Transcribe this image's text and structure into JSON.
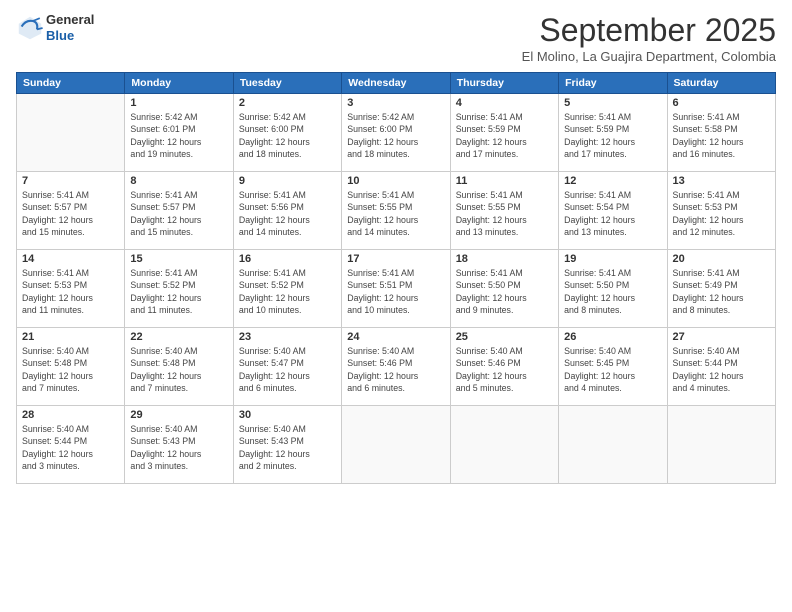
{
  "logo": {
    "general": "General",
    "blue": "Blue"
  },
  "title": "September 2025",
  "location": "El Molino, La Guajira Department, Colombia",
  "days_of_week": [
    "Sunday",
    "Monday",
    "Tuesday",
    "Wednesday",
    "Thursday",
    "Friday",
    "Saturday"
  ],
  "weeks": [
    [
      {
        "day": "",
        "info": ""
      },
      {
        "day": "1",
        "info": "Sunrise: 5:42 AM\nSunset: 6:01 PM\nDaylight: 12 hours\nand 19 minutes."
      },
      {
        "day": "2",
        "info": "Sunrise: 5:42 AM\nSunset: 6:00 PM\nDaylight: 12 hours\nand 18 minutes."
      },
      {
        "day": "3",
        "info": "Sunrise: 5:42 AM\nSunset: 6:00 PM\nDaylight: 12 hours\nand 18 minutes."
      },
      {
        "day": "4",
        "info": "Sunrise: 5:41 AM\nSunset: 5:59 PM\nDaylight: 12 hours\nand 17 minutes."
      },
      {
        "day": "5",
        "info": "Sunrise: 5:41 AM\nSunset: 5:59 PM\nDaylight: 12 hours\nand 17 minutes."
      },
      {
        "day": "6",
        "info": "Sunrise: 5:41 AM\nSunset: 5:58 PM\nDaylight: 12 hours\nand 16 minutes."
      }
    ],
    [
      {
        "day": "7",
        "info": "Sunrise: 5:41 AM\nSunset: 5:57 PM\nDaylight: 12 hours\nand 15 minutes."
      },
      {
        "day": "8",
        "info": "Sunrise: 5:41 AM\nSunset: 5:57 PM\nDaylight: 12 hours\nand 15 minutes."
      },
      {
        "day": "9",
        "info": "Sunrise: 5:41 AM\nSunset: 5:56 PM\nDaylight: 12 hours\nand 14 minutes."
      },
      {
        "day": "10",
        "info": "Sunrise: 5:41 AM\nSunset: 5:55 PM\nDaylight: 12 hours\nand 14 minutes."
      },
      {
        "day": "11",
        "info": "Sunrise: 5:41 AM\nSunset: 5:55 PM\nDaylight: 12 hours\nand 13 minutes."
      },
      {
        "day": "12",
        "info": "Sunrise: 5:41 AM\nSunset: 5:54 PM\nDaylight: 12 hours\nand 13 minutes."
      },
      {
        "day": "13",
        "info": "Sunrise: 5:41 AM\nSunset: 5:53 PM\nDaylight: 12 hours\nand 12 minutes."
      }
    ],
    [
      {
        "day": "14",
        "info": "Sunrise: 5:41 AM\nSunset: 5:53 PM\nDaylight: 12 hours\nand 11 minutes."
      },
      {
        "day": "15",
        "info": "Sunrise: 5:41 AM\nSunset: 5:52 PM\nDaylight: 12 hours\nand 11 minutes."
      },
      {
        "day": "16",
        "info": "Sunrise: 5:41 AM\nSunset: 5:52 PM\nDaylight: 12 hours\nand 10 minutes."
      },
      {
        "day": "17",
        "info": "Sunrise: 5:41 AM\nSunset: 5:51 PM\nDaylight: 12 hours\nand 10 minutes."
      },
      {
        "day": "18",
        "info": "Sunrise: 5:41 AM\nSunset: 5:50 PM\nDaylight: 12 hours\nand 9 minutes."
      },
      {
        "day": "19",
        "info": "Sunrise: 5:41 AM\nSunset: 5:50 PM\nDaylight: 12 hours\nand 8 minutes."
      },
      {
        "day": "20",
        "info": "Sunrise: 5:41 AM\nSunset: 5:49 PM\nDaylight: 12 hours\nand 8 minutes."
      }
    ],
    [
      {
        "day": "21",
        "info": "Sunrise: 5:40 AM\nSunset: 5:48 PM\nDaylight: 12 hours\nand 7 minutes."
      },
      {
        "day": "22",
        "info": "Sunrise: 5:40 AM\nSunset: 5:48 PM\nDaylight: 12 hours\nand 7 minutes."
      },
      {
        "day": "23",
        "info": "Sunrise: 5:40 AM\nSunset: 5:47 PM\nDaylight: 12 hours\nand 6 minutes."
      },
      {
        "day": "24",
        "info": "Sunrise: 5:40 AM\nSunset: 5:46 PM\nDaylight: 12 hours\nand 6 minutes."
      },
      {
        "day": "25",
        "info": "Sunrise: 5:40 AM\nSunset: 5:46 PM\nDaylight: 12 hours\nand 5 minutes."
      },
      {
        "day": "26",
        "info": "Sunrise: 5:40 AM\nSunset: 5:45 PM\nDaylight: 12 hours\nand 4 minutes."
      },
      {
        "day": "27",
        "info": "Sunrise: 5:40 AM\nSunset: 5:44 PM\nDaylight: 12 hours\nand 4 minutes."
      }
    ],
    [
      {
        "day": "28",
        "info": "Sunrise: 5:40 AM\nSunset: 5:44 PM\nDaylight: 12 hours\nand 3 minutes."
      },
      {
        "day": "29",
        "info": "Sunrise: 5:40 AM\nSunset: 5:43 PM\nDaylight: 12 hours\nand 3 minutes."
      },
      {
        "day": "30",
        "info": "Sunrise: 5:40 AM\nSunset: 5:43 PM\nDaylight: 12 hours\nand 2 minutes."
      },
      {
        "day": "",
        "info": ""
      },
      {
        "day": "",
        "info": ""
      },
      {
        "day": "",
        "info": ""
      },
      {
        "day": "",
        "info": ""
      }
    ]
  ]
}
